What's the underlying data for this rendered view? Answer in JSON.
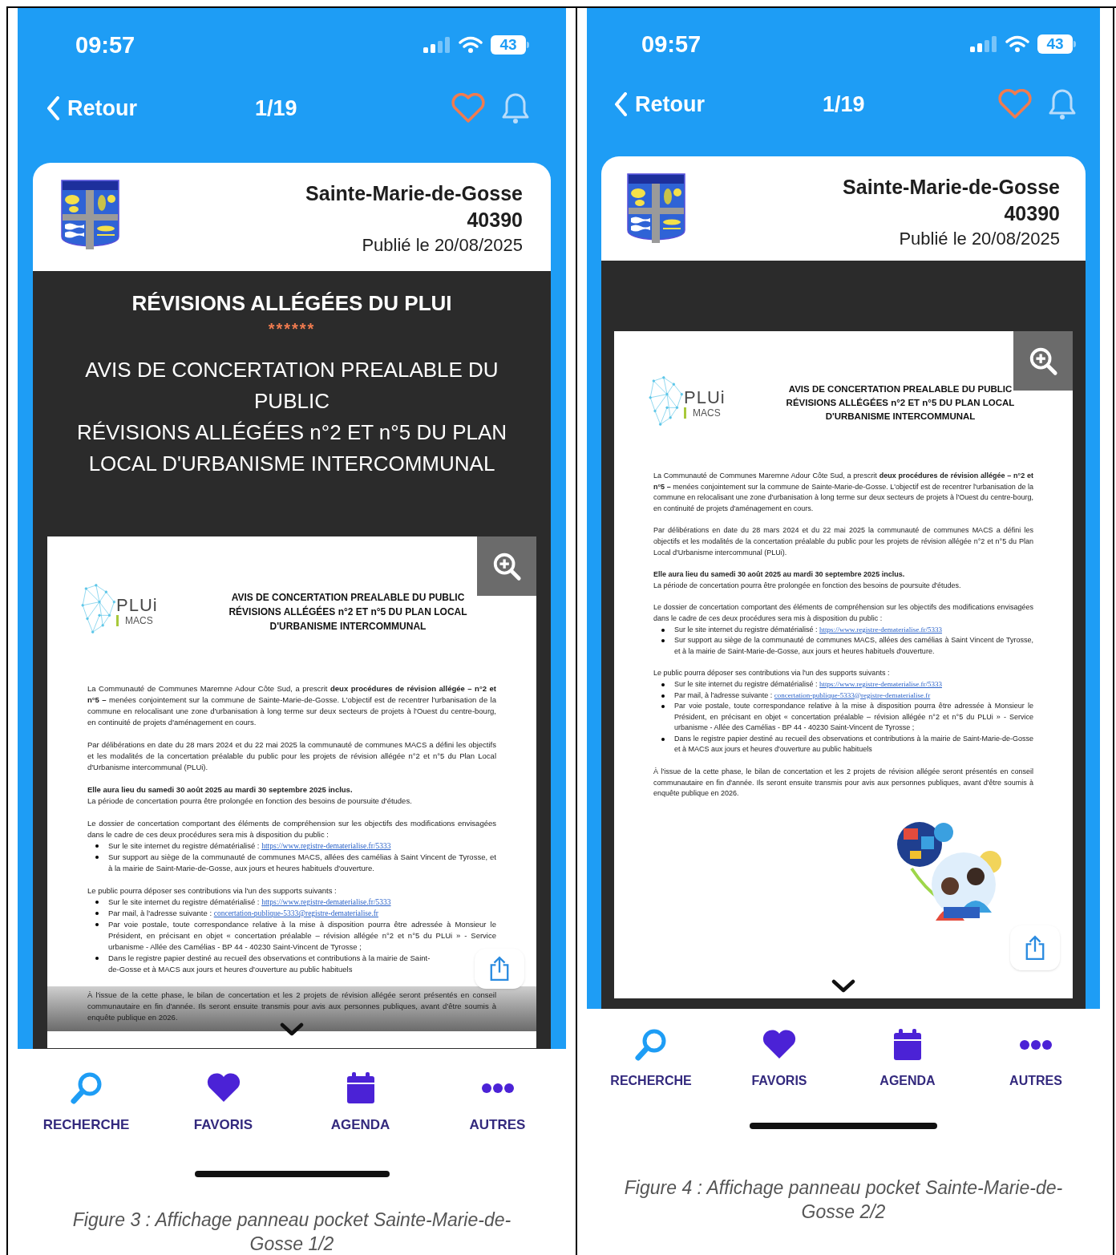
{
  "figures": [
    {
      "status_bar": {
        "time": "09:57",
        "battery": "43"
      },
      "nav": {
        "back": "Retour",
        "counter": "1/19"
      },
      "card": {
        "city": "Sainte-Marie-de-Gosse",
        "postcode": "40390",
        "published": "Publié le 20/08/2025"
      },
      "banner": {
        "title": "RÉVISIONS ALLÉGÉES DU PLUI",
        "separator": "******",
        "lines": [
          "AVIS DE CONCERTATION PREALABLE DU PUBLIC",
          "RÉVISIONS ALLÉGÉES n°2 ET n°5 DU PLAN LOCAL D'URBANISME INTERCOMMUNAL"
        ]
      },
      "notice": {
        "faded_bottom": true,
        "logo_main": "PLUi",
        "logo_sub": "MACS",
        "heading_lines": [
          "AVIS DE CONCERTATION PREALABLE DU PUBLIC",
          "RÉVISIONS ALLÉGÉES n°2 ET n°5 DU PLAN LOCAL",
          "D'URBANISME INTERCOMMUNAL"
        ],
        "blocks": [
          {
            "kind": "paragraph",
            "lines": [
              "La Communauté de Communes Maremne Adour Côte Sud, a prescrit **deux procédures de révision allégée – n°2 et n°5 –** menées conjointement sur la commune de Sainte-Marie-de-Gosse. L'objectif est de recentrer l'urbanisation de la commune en relocalisant une zone d'urbanisation à long terme sur deux secteurs de projets à l'Ouest du centre-bourg, en continuité de projets d'aménagement en cours."
            ]
          },
          {
            "kind": "paragraph",
            "lines": [
              "Par délibérations en date du 28 mars 2024 et du 22 mai 2025 la communauté de communes MACS a défini les objectifs et les modalités de la concertation préalable du public pour les projets de révision allégée n°2 et n°5 du Plan Local d'Urbanisme intercommunal (PLUi)."
            ]
          },
          {
            "kind": "paragraph",
            "lines": [
              "**Elle aura lieu du samedi 30 août 2025 au mardi 30 septembre 2025 inclus.**",
              "La période de concertation pourra être prolongée en fonction des besoins de poursuite d'études."
            ]
          },
          {
            "kind": "list",
            "intro": "Le dossier de concertation comportant des éléments de compréhension sur les objectifs des modifications envisagées dans le cadre de ces deux procédures sera mis à disposition du public :",
            "items": [
              {
                "text": "Sur le site internet du registre dématérialisé : ",
                "link": "https://www.registre-dematerialise.fr/5333"
              },
              {
                "text": "Sur support au siège de la communauté de communes MACS, allées des camélias à Saint Vincent de Tyrosse, et à la mairie de Saint-Marie-de-Gosse, aux jours et heures habituels d'ouverture."
              }
            ]
          },
          {
            "kind": "list",
            "intro": "Le public pourra déposer ses contributions via l'un des supports suivants :",
            "items": [
              {
                "text": "Sur le site internet du registre dématérialisé : ",
                "link": "https://www.registre-dematerialise.fr/5333"
              },
              {
                "text": "Par mail, à l'adresse suivante : ",
                "link": "concertation-publique-5333@registre-dematerialise.fr"
              },
              {
                "text": "Par voie postale, toute correspondance relative à la mise à disposition pourra être adressée à Monsieur le Président, en précisant en objet « concertation préalable – révision allégée n°2 et n°5 du PLUi » - Service urbanisme - Allée des Camélias - BP 44 - 40230 Saint-Vincent de Tyrosse ;"
              },
              {
                "lines": [
                  "Dans le registre papier destiné au recueil des observations et contributions à la mairie de Saint-",
                  "de-Gosse et à MACS aux jours et heures d'ouverture au public habituels"
                ]
              }
            ]
          },
          {
            "kind": "paragraph",
            "lines": [
              "À l'issue de la cette phase, le bilan de concertation et les 2 projets de révision allégée seront présentés en conseil communautaire en fin d'année. Ils seront ensuite transmis pour avis aux personnes publiques, avant d'être soumis à enquête publique en 2026."
            ]
          }
        ]
      },
      "tabs": [
        {
          "label": "RECHERCHE"
        },
        {
          "label": "FAVORIS"
        },
        {
          "label": "AGENDA"
        },
        {
          "label": "AUTRES"
        }
      ],
      "caption": "Figure 3 : Affichage panneau pocket Sainte-Marie-de-Gosse  1/2"
    },
    {
      "status_bar": {
        "time": "09:57",
        "battery": "43"
      },
      "nav": {
        "back": "Retour",
        "counter": "1/19"
      },
      "card": {
        "city": "Sainte-Marie-de-Gosse",
        "postcode": "40390",
        "published": "Publié le 20/08/2025"
      },
      "notice": {
        "logo_main": "PLUi",
        "logo_sub": "MACS",
        "heading_lines": [
          "AVIS DE CONCERTATION PREALABLE DU PUBLIC",
          "RÉVISIONS ALLÉGÉES n°2 ET n°5 DU PLAN LOCAL",
          "D'URBANISME INTERCOMMUNAL"
        ],
        "blocks": [
          {
            "kind": "paragraph",
            "lines": [
              "La Communauté de Communes Maremne Adour Côte Sud, a prescrit **deux procédures de révision allégée – n°2 et n°5 –** menées conjointement sur la commune de Sainte-Marie-de-Gosse. L'objectif est de recentrer l'urbanisation de la commune en relocalisant une zone d'urbanisation à long terme sur deux secteurs de projets à l'Ouest du centre-bourg, en continuité de projets d'aménagement en cours."
            ]
          },
          {
            "kind": "paragraph",
            "lines": [
              "Par délibérations en date du 28 mars 2024 et du 22 mai 2025 la communauté de communes MACS a défini les objectifs et les modalités de la concertation préalable du public pour les projets de révision allégée n°2 et n°5 du Plan Local d'Urbanisme intercommunal (PLUi)."
            ]
          },
          {
            "kind": "paragraph",
            "lines": [
              "**Elle aura lieu du samedi 30 août 2025 au mardi 30 septembre 2025 inclus.**",
              "La période de concertation pourra être prolongée en fonction des besoins de poursuite d'études."
            ]
          },
          {
            "kind": "list",
            "intro": "Le dossier de concertation comportant des éléments de compréhension sur les objectifs des modifications envisagées dans le cadre de ces deux procédures sera mis à disposition du public :",
            "items": [
              {
                "text": "Sur le site internet du registre dématérialisé : ",
                "link": "https://www.registre-dematerialise.fr/5333"
              },
              {
                "text": "Sur support au siège de la communauté de communes MACS, allées des camélias à Saint Vincent de Tyrosse, et à la mairie de Saint-Marie-de-Gosse, aux jours et heures habituels d'ouverture."
              }
            ]
          },
          {
            "kind": "list",
            "intro": "Le public pourra déposer ses contributions via l'un des supports suivants :",
            "items": [
              {
                "text": "Sur le site internet du registre dématérialisé : ",
                "link": "https://www.registre-dematerialise.fr/5333"
              },
              {
                "text": "Par mail, à l'adresse suivante : ",
                "link": "concertation-publique-5333@registre-dematerialise.fr"
              },
              {
                "text": "Par voie postale, toute correspondance relative à la mise à disposition pourra être adressée à Monsieur le Président, en précisant en objet « concertation préalable – révision allégée n°2 et n°5 du PLUi » - Service urbanisme - Allée des Camélias - BP 44 - 40230 Saint-Vincent de Tyrosse ;"
              },
              {
                "text": "Dans le registre papier destiné au recueil des observations et contributions à la mairie de Saint-Marie-de-Gosse et à MACS aux jours et heures d'ouverture au public habituels"
              }
            ]
          },
          {
            "kind": "paragraph",
            "lines": [
              "À l'issue de la cette phase, le bilan de concertation et les 2 projets de révision allégée seront présentés en conseil communautaire en fin d'année. Ils seront ensuite transmis pour avis aux personnes publiques, avant d'être soumis à enquête publique en 2026."
            ]
          },
          {
            "kind": "picture"
          }
        ]
      },
      "tabs": [
        {
          "label": "RECHERCHE"
        },
        {
          "label": "FAVORIS"
        },
        {
          "label": "AGENDA"
        },
        {
          "label": "AUTRES"
        }
      ],
      "caption": "Figure 4 : Affichage panneau pocket Sainte-Marie-de-Gosse  2/2"
    }
  ]
}
